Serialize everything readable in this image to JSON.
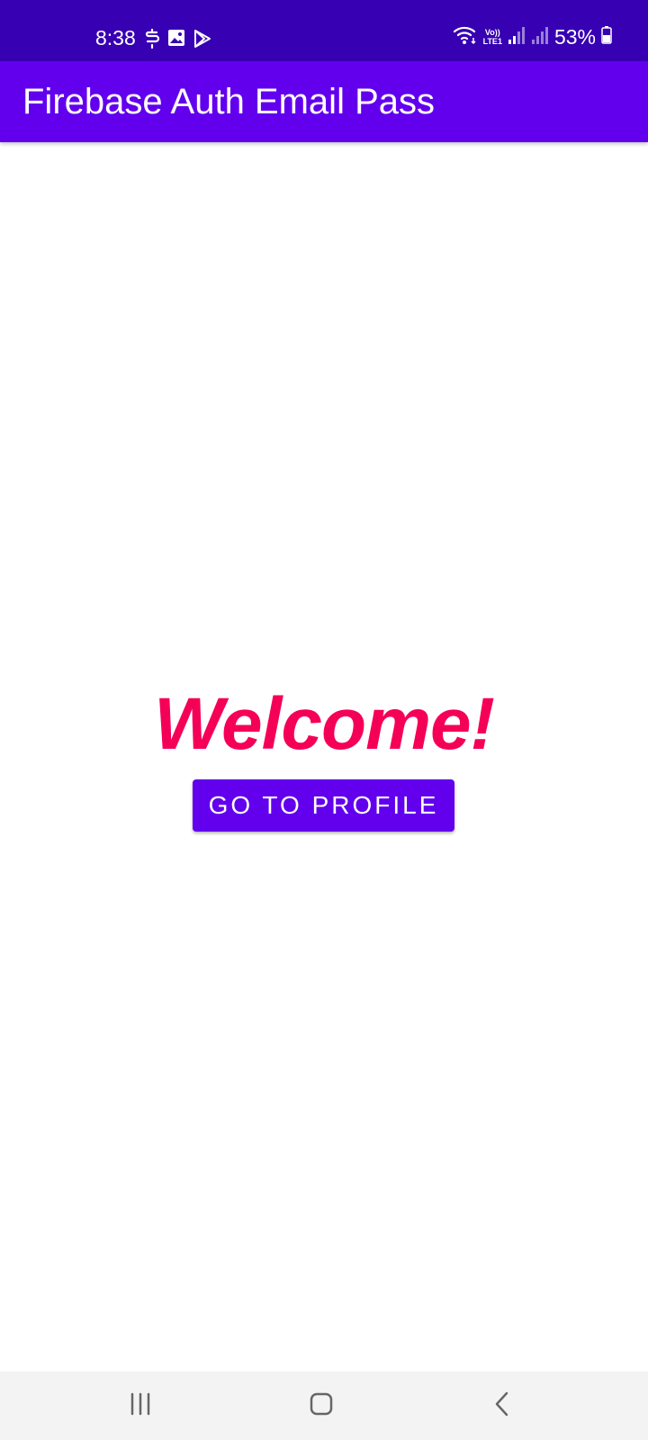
{
  "status_bar": {
    "time": "8:38",
    "lte_label_top": "Vo))",
    "lte_label_bottom": "LTE1",
    "battery_percent": "53%",
    "left_icons": [
      "s-app-icon",
      "gallery-icon",
      "play-store-icon"
    ],
    "right_icons": [
      "wifi-icon",
      "lte-icon",
      "signal-icon",
      "signal-icon-2",
      "battery-icon"
    ]
  },
  "app_bar": {
    "title": "Firebase Auth Email Pass"
  },
  "main": {
    "welcome_text": "Welcome!",
    "profile_button_label": "GO TO PROFILE"
  },
  "nav_bar": {
    "items": [
      "recents-icon",
      "home-icon",
      "back-icon"
    ]
  },
  "colors": {
    "status_bar": "#3700b3",
    "app_bar": "#6200ee",
    "welcome_text": "#f50057",
    "button": "#6200ee",
    "nav_bar": "#f3f3f3"
  }
}
